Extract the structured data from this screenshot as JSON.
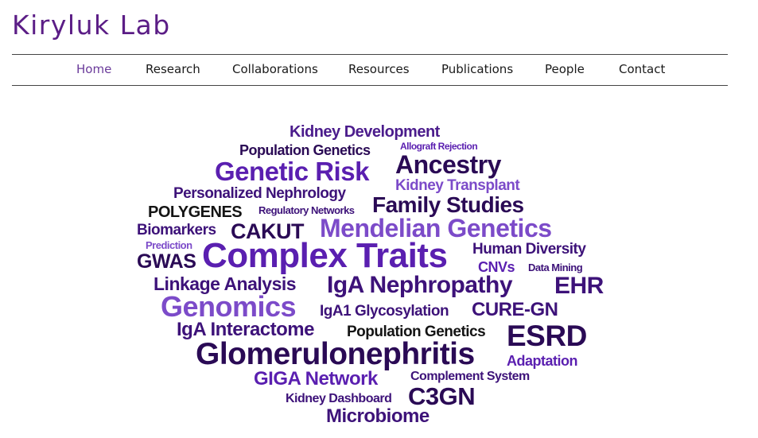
{
  "site": {
    "title": "Kiryluk Lab"
  },
  "nav": {
    "items": [
      "Home",
      "Research",
      "Collaborations",
      "Resources",
      "Publications",
      "People",
      "Contact"
    ],
    "active": "Home"
  },
  "word_cloud": {
    "words": [
      "Kidney Development",
      "Population Genetics",
      "Allograft Rejection",
      "Genetic Risk",
      "Ancestry",
      "Personalized Nephrology",
      "Kidney Transplant",
      "POLYGENES",
      "Regulatory Networks",
      "Family Studies",
      "Biomarkers",
      "CAKUT",
      "Mendelian Genetics",
      "Prediction",
      "GWAS",
      "Complex Traits",
      "Human Diversity",
      "CNVs",
      "Data Mining",
      "Linkage Analysis",
      "IgA Nephropathy",
      "EHR",
      "Genomics",
      "IgA1 Glycosylation",
      "CURE-GN",
      "IgA Interactome",
      "Population Genetics",
      "ESRD",
      "Glomerulonephritis",
      "Adaptation",
      "GIGA Network",
      "Complement System",
      "Kidney Dashboard",
      "C3GN",
      "Microbiome"
    ]
  },
  "colors": {
    "title": "#5b1d86",
    "nav_active": "#6a3a9a",
    "cloud_dark": "#2a0a55",
    "cloud_purple": "#5a1fb0",
    "cloud_light": "#7c4bc9"
  }
}
